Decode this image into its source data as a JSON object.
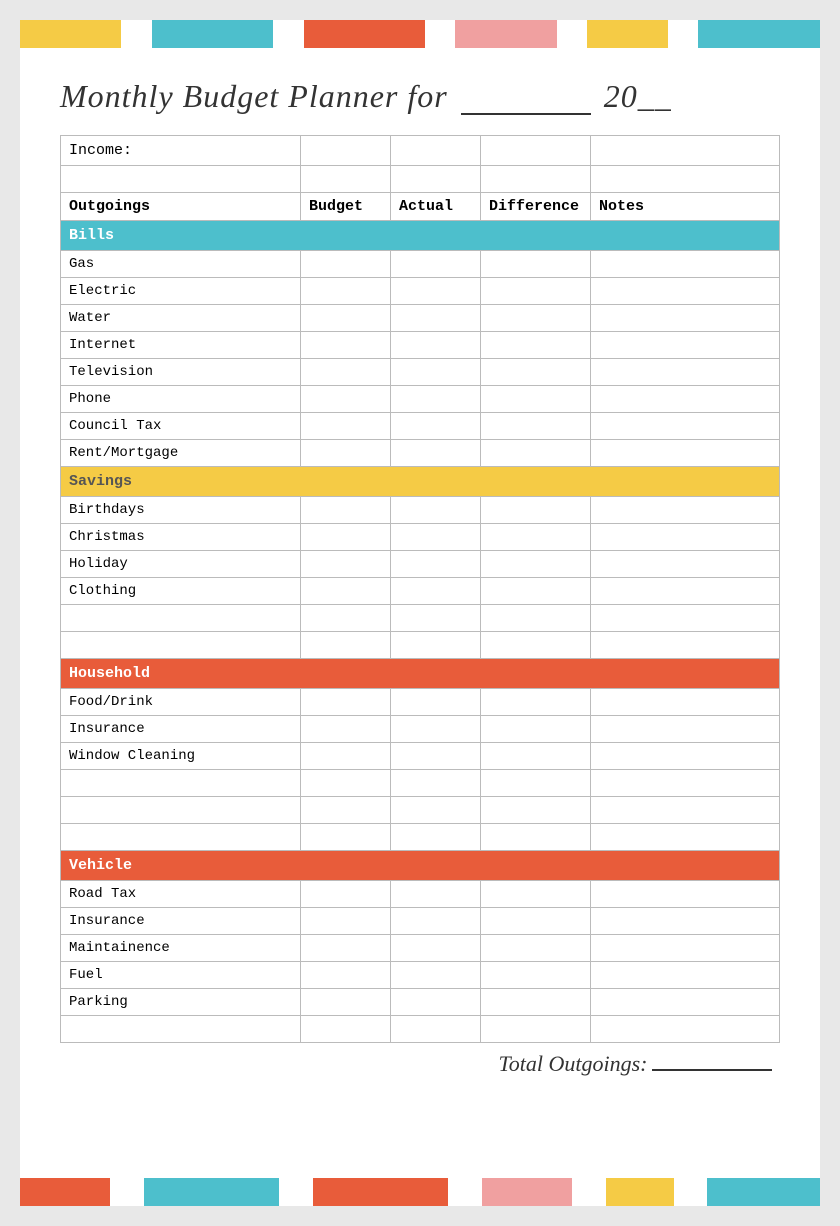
{
  "colorBarsTop": [
    {
      "color": "#f5cb45",
      "flex": 1
    },
    {
      "color": "#ffffff",
      "flex": 0.3
    },
    {
      "color": "#4dbfcc",
      "flex": 1.2
    },
    {
      "color": "#ffffff",
      "flex": 0.3
    },
    {
      "color": "#e85c3a",
      "flex": 1.2
    },
    {
      "color": "#ffffff",
      "flex": 0.3
    },
    {
      "color": "#f0a0a0",
      "flex": 1
    },
    {
      "color": "#ffffff",
      "flex": 0.3
    },
    {
      "color": "#f5cb45",
      "flex": 0.8
    },
    {
      "color": "#ffffff",
      "flex": 0.3
    },
    {
      "color": "#4dbfcc",
      "flex": 1.2
    }
  ],
  "colorBarsBottom": [
    {
      "color": "#e85c3a",
      "flex": 0.8
    },
    {
      "color": "#ffffff",
      "flex": 0.3
    },
    {
      "color": "#4dbfcc",
      "flex": 1.2
    },
    {
      "color": "#ffffff",
      "flex": 0.3
    },
    {
      "color": "#e85c3a",
      "flex": 1.2
    },
    {
      "color": "#ffffff",
      "flex": 0.3
    },
    {
      "color": "#f0a0a0",
      "flex": 0.8
    },
    {
      "color": "#ffffff",
      "flex": 0.3
    },
    {
      "color": "#f5cb45",
      "flex": 0.6
    },
    {
      "color": "#ffffff",
      "flex": 0.3
    },
    {
      "color": "#4dbfcc",
      "flex": 1.0
    }
  ],
  "title": "Monthly Budget Planner for",
  "title_year": "20",
  "income_label": "Income:",
  "columns": {
    "outgoings": "Outgoings",
    "budget": "Budget",
    "actual": "Actual",
    "difference": "Difference",
    "notes": "Notes"
  },
  "sections": [
    {
      "name": "Bills",
      "color": "bills",
      "items": [
        "Gas",
        "Electric",
        "Water",
        "Internet",
        "Television",
        "Phone",
        "Council Tax",
        "Rent/Mortgage"
      ]
    },
    {
      "name": "Savings",
      "color": "savings",
      "items": [
        "Birthdays",
        "Christmas",
        "Holiday",
        "Clothing",
        "",
        ""
      ]
    },
    {
      "name": "Household",
      "color": "household",
      "items": [
        "Food/Drink",
        "Insurance",
        "Window Cleaning",
        "",
        "",
        ""
      ]
    },
    {
      "name": "Vehicle",
      "color": "vehicle",
      "items": [
        "Road Tax",
        "Insurance",
        "Maintainence",
        "Fuel",
        "Parking",
        ""
      ]
    }
  ],
  "total_label": "Total Outgoings:"
}
